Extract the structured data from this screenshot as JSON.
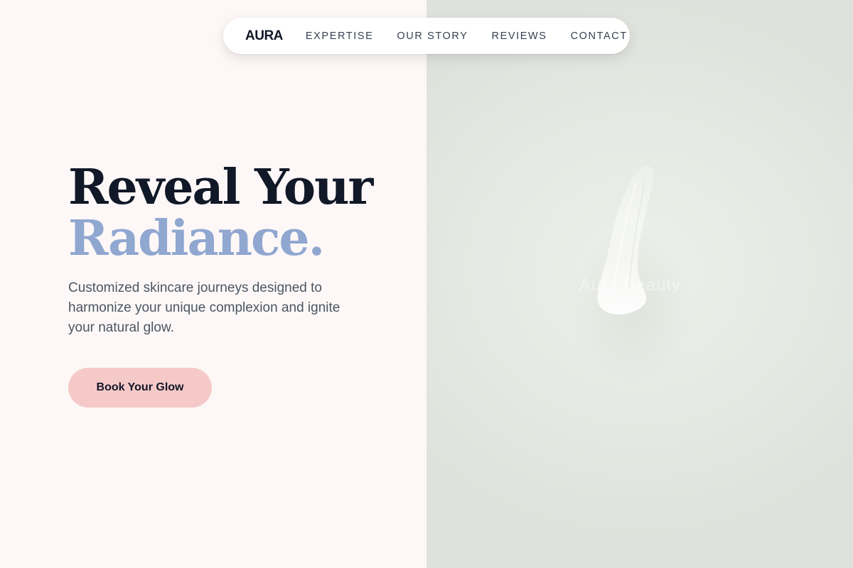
{
  "nav": {
    "logo": "AURA",
    "links": [
      "EXPERTISE",
      "OUR STORY",
      "REVIEWS",
      "CONTACT"
    ]
  },
  "hero": {
    "headline_line1": "Reveal Your",
    "headline_line2": "Radiance.",
    "subtext": "Customized skincare journeys designed to harmonize your unique complexion and ignite your natural glow.",
    "cta_label": "Book Your Glow"
  },
  "image": {
    "watermark": "Aura Beauty"
  },
  "colors": {
    "background": "#fdf8f7",
    "headline": "#111827",
    "accent": "#90a7d0",
    "body_text": "#4b5563",
    "cta_background": "#f6c9c9",
    "image_background": "#e6e9e3"
  }
}
